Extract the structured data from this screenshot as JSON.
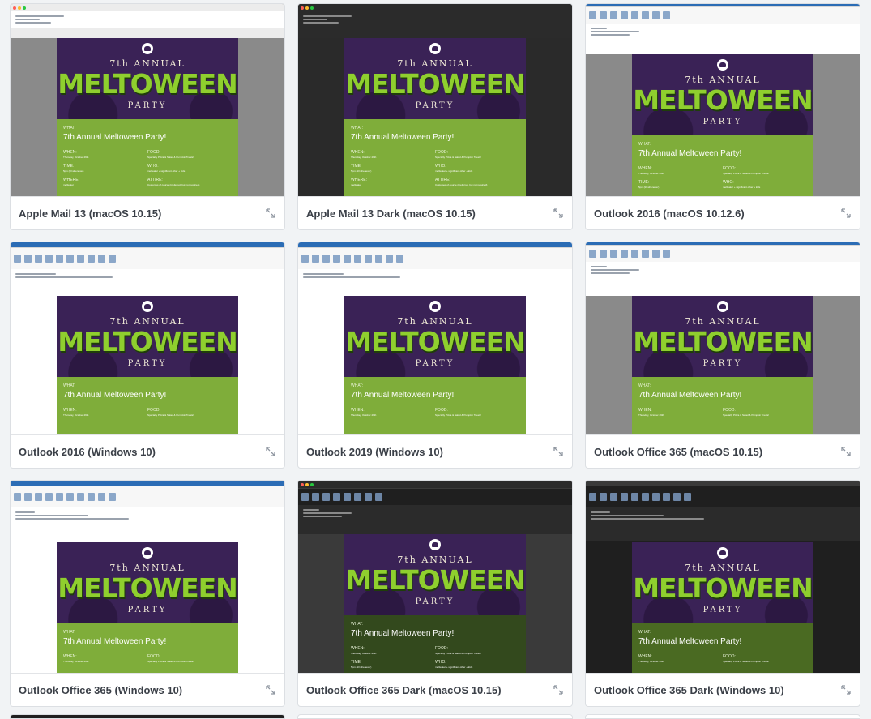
{
  "email": {
    "annual": "7th ANNUAL",
    "brand": "MELTOWEEN",
    "party": "PARTY",
    "what_label": "WHAT:",
    "title": "7th Annual Meltoween Party!",
    "when_label": "WHEN:",
    "when_value": "Thursday, October 29th",
    "food_label": "FOOD:",
    "food_value": "Specialty Pizza & Salad & Pumpkin Treats!",
    "time_label": "TIME:",
    "time_value": "5pm (till whenever)",
    "who_label": "WHO:",
    "who_value": "meltwater + significant other + kids",
    "where_label": "WHERE:",
    "where_value": "meltwater",
    "attire_label": "ATTIRE:",
    "attire_value": "Costumes of course (preferred, but not required)"
  },
  "cards": [
    {
      "label": "Apple Mail 13 (macOS 10.15)",
      "theme": "light"
    },
    {
      "label": "Apple Mail 13 Dark (macOS 10.15)",
      "theme": "dark"
    },
    {
      "label": "Outlook 2016 (macOS 10.12.6)",
      "theme": "light"
    },
    {
      "label": "Outlook 2016 (Windows 10)",
      "theme": "light"
    },
    {
      "label": "Outlook 2019 (Windows 10)",
      "theme": "light"
    },
    {
      "label": "Outlook Office 365 (macOS 10.15)",
      "theme": "light"
    },
    {
      "label": "Outlook Office 365 (Windows 10)",
      "theme": "light"
    },
    {
      "label": "Outlook Office 365 Dark (macOS 10.15)",
      "theme": "dark"
    },
    {
      "label": "Outlook Office 365 Dark (Windows 10)",
      "theme": "dark"
    }
  ],
  "icons": {
    "expand": "expand-arrows-icon"
  },
  "colors": {
    "purple": "#3a2256",
    "green": "#8fcf2e",
    "panel": "#7fad3a",
    "page_bg": "#f1f3f5"
  }
}
